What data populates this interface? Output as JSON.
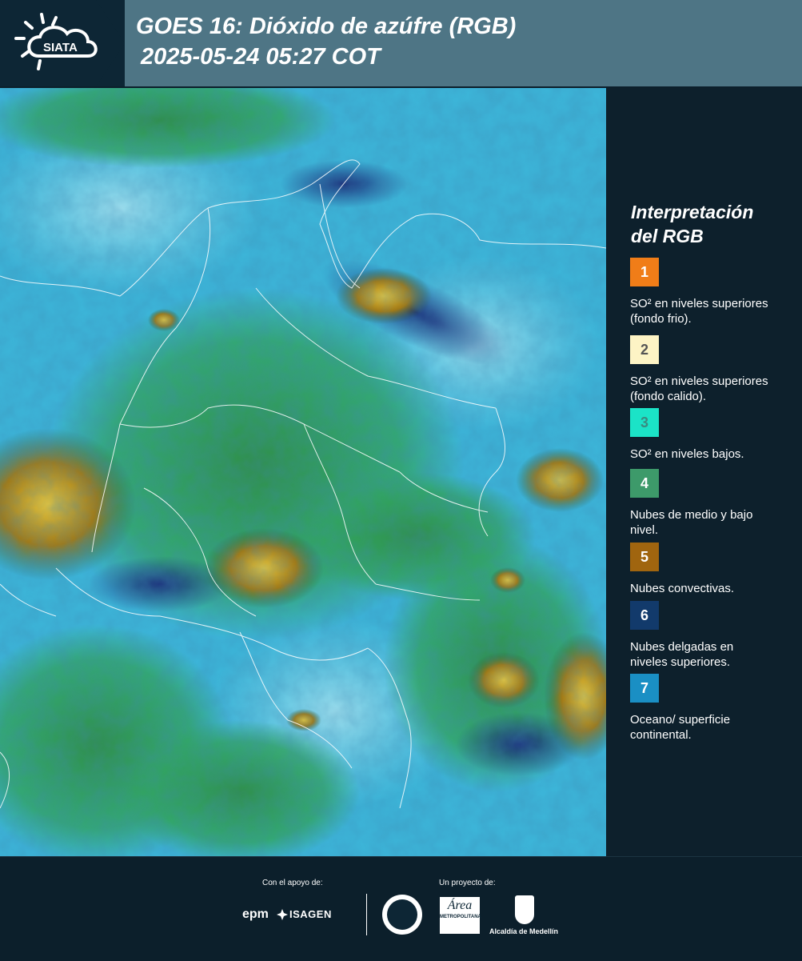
{
  "header": {
    "logo_text": "SIATA",
    "title_line1": "GOES 16: Dióxido de azúfre (RGB)",
    "title_line2": "2025-05-24 05:27 COT"
  },
  "legend": {
    "title_line1": "Interpretación",
    "title_line2": "del RGB",
    "items": [
      {
        "number": "1",
        "label": "SO² en niveles superiores (fondo frio).",
        "color": "#f07d18",
        "text_color": "#ffffff"
      },
      {
        "number": "2",
        "label": "SO² en niveles superiores (fondo calido).",
        "color": "#fdf4c5",
        "text_color": "#555555"
      },
      {
        "number": "3",
        "label": "SO² en niveles bajos.",
        "color": "#1be3c7",
        "text_color": "#3a8a80"
      },
      {
        "number": "4",
        "label": "Nubes de medio y bajo nivel.",
        "color": "#3d9a6a",
        "text_color": "#ffffff"
      },
      {
        "number": "5",
        "label": "Nubes convectivas.",
        "color": "#a0650f",
        "text_color": "#ffffff"
      },
      {
        "number": "6",
        "label": "Nubes delgadas en niveles superiores.",
        "color": "#123a6b",
        "text_color": "#ffffff"
      },
      {
        "number": "7",
        "label": "Oceano/ superficie continental.",
        "color": "#1a8fc4",
        "text_color": "#ffffff"
      }
    ]
  },
  "footer": {
    "support_label": "Con el apoyo de:",
    "project_label": "Un proyecto de:",
    "sponsor1": "epm",
    "sponsor2": "ISAGEN",
    "partner_area": "Área",
    "partner_area_sub": "METROPOLITANA",
    "partner_alcaldia": "Alcaldía de Medellín"
  },
  "map": {
    "ocean_color": "#39b2d6",
    "vegetation_color": "#2ea35a",
    "convective_color": "#c9a21a",
    "cloud_dark_color": "#1a3c8f"
  }
}
